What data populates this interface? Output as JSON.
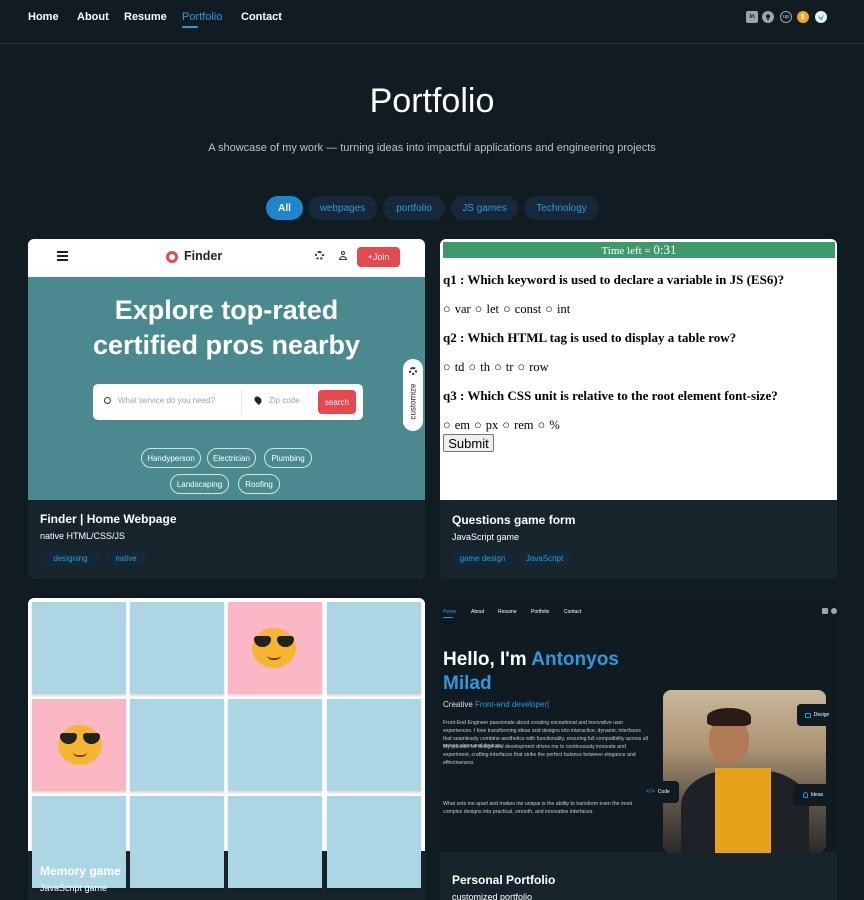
{
  "nav": {
    "links": [
      "Home",
      "About",
      "Resume",
      "Portfolio",
      "Contact"
    ],
    "active": "Portfolio",
    "social_icons": [
      "linkedin-icon",
      "github-icon",
      "upwork-icon",
      "freelancer-coin-icon",
      "mostaql-bird-icon"
    ]
  },
  "hero": {
    "title": "Portfolio",
    "subtitle": "A showcase of my work — turning ideas into impactful applications and engineering projects"
  },
  "filters": {
    "items": [
      "All",
      "webpages",
      "portfolio",
      "JS games",
      "Technology"
    ],
    "active": "All"
  },
  "colors": {
    "background": "#111b22",
    "accent": "#1d87cc",
    "card": "#18242c"
  },
  "projects": [
    {
      "title": "Finder | Home Webpage",
      "subtitle": "native HTML/CSS/JS",
      "tags": [
        "designing",
        "native"
      ],
      "preview": {
        "logo": "Finder",
        "join_label": "+Join",
        "headline_line1": "Explore top-rated",
        "headline_line2": "certified pros nearby",
        "search_placeholder": "What service do you need?",
        "zip_placeholder": "Zip code",
        "search_button": "search",
        "chips": [
          "Handyperson",
          "Electrician",
          "Plumbing",
          "Landscaping",
          "Roofing"
        ],
        "customize_label": "customize"
      }
    },
    {
      "title": "Questions game form",
      "subtitle": "JavaScript game",
      "tags": [
        "game design",
        "JavaScript"
      ],
      "preview": {
        "timer_label": "Time left = ",
        "timer_value": "0:31",
        "questions": [
          {
            "q": "q1 : Which keyword is used to declare a variable in JS (ES6)?",
            "options": [
              "var",
              "let",
              "const",
              "int"
            ]
          },
          {
            "q": "q2 : Which HTML tag is used to display a table row?",
            "options": [
              "td",
              "th",
              "tr",
              "row"
            ]
          },
          {
            "q": "q3 : Which CSS unit is relative to the root element font-size?",
            "options": [
              "em",
              "px",
              "rem",
              "%"
            ]
          }
        ],
        "submit_label": "Submit"
      }
    },
    {
      "title": "Memory game",
      "subtitle": "JavaScript game",
      "tags": [],
      "preview": {
        "revealed_emoji": "😎"
      }
    },
    {
      "title": "Personal Portfolio",
      "subtitle": "customized portfolio",
      "tags": [],
      "preview": {
        "nav": [
          "Home",
          "About",
          "Resume",
          "Portfolio",
          "Contact"
        ],
        "greeting": "Hello, I'm ",
        "name_line1": "Antonyos",
        "name_line2": "Milad",
        "role_prefix": "Creative ",
        "role": "Front-end developer|",
        "para1": "Front-End Engineer passionate about creating exceptional and innovative user experiences. I love transforming ideas and designs into interactive, dynamic interfaces that seamlessly combine aesthetics with functionality, ensuring full compatibility across all screen sizes and devices.",
        "para2": "My passion for design and development drives me to continuously innovate and experiment, crafting interfaces that strike the perfect balance between elegance and effectiveness.",
        "para3": "What sets me apart and makes me unique is the ability to transform even the most complex designs into practical, smooth, and innovative interfaces.",
        "badges": [
          "Design",
          "Code",
          "Ideas"
        ]
      }
    }
  ]
}
